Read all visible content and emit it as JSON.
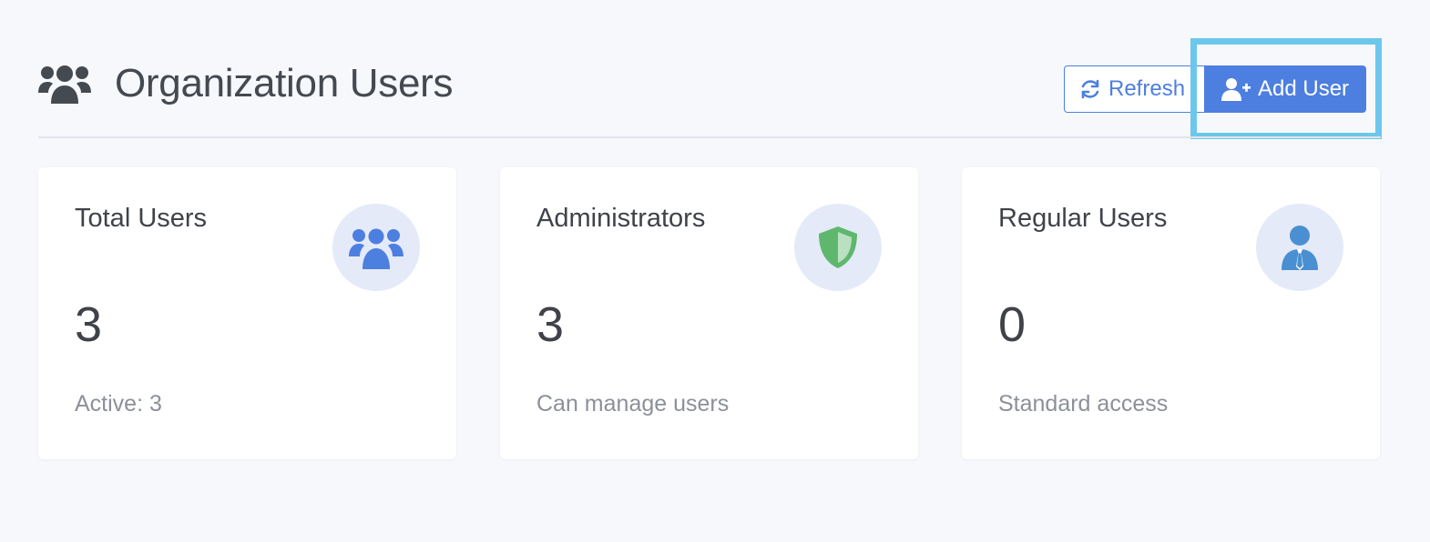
{
  "header": {
    "title": "Organization Users",
    "icon": "users-icon"
  },
  "toolbar": {
    "refresh_label": "Refresh",
    "refresh_icon": "refresh-icon",
    "add_user_label": "Add User",
    "add_user_icon": "user-plus-icon"
  },
  "colors": {
    "primary": "#4d7fe0",
    "background": "#f7f8fc",
    "shield": "#5fb76e",
    "person": "#4a8fd1",
    "highlight": "#6cc7ec"
  },
  "cards": [
    {
      "title": "Total Users",
      "value": "3",
      "subtitle": "Active: 3",
      "icon": "users-icon"
    },
    {
      "title": "Administrators",
      "value": "3",
      "subtitle": "Can manage users",
      "icon": "shield-icon"
    },
    {
      "title": "Regular Users",
      "value": "0",
      "subtitle": "Standard access",
      "icon": "user-tie-icon"
    }
  ]
}
